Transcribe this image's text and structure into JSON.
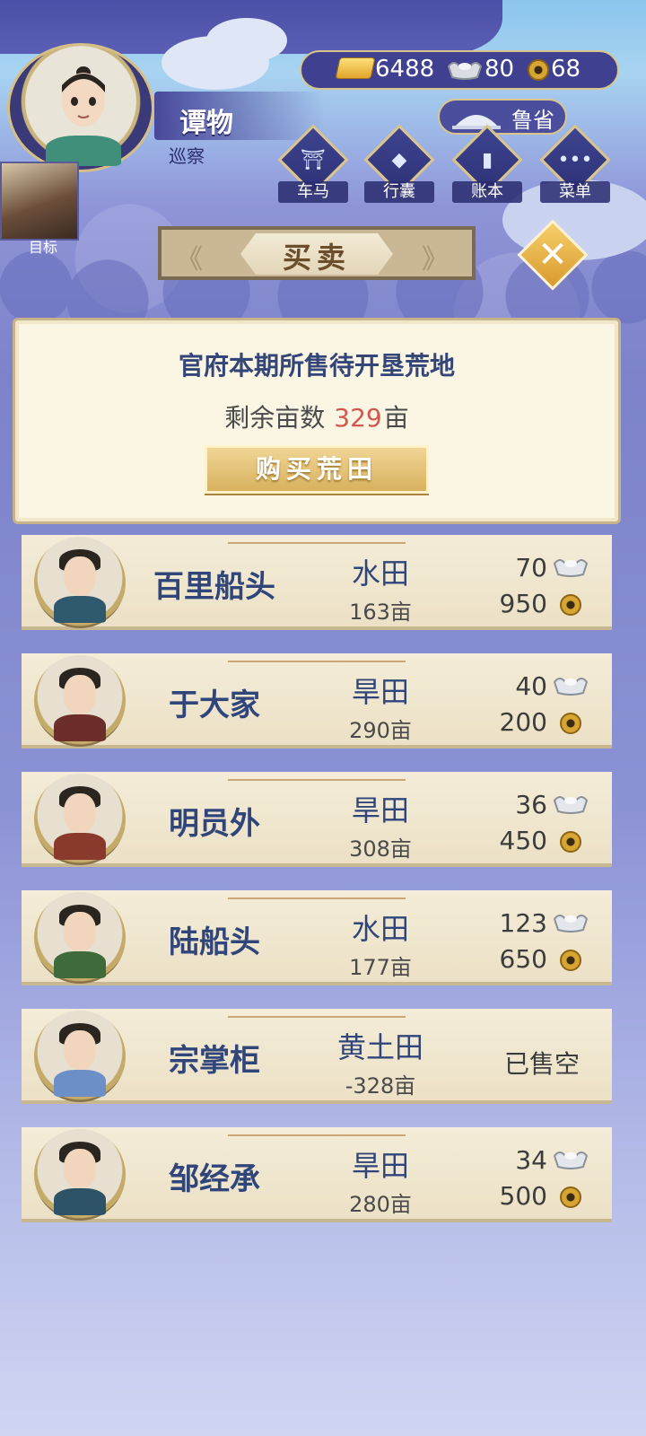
{
  "player": {
    "name": "谭物",
    "title": "巡察",
    "target_label": "目标"
  },
  "currency": {
    "gold": "6488",
    "silver": "80",
    "copper": "68"
  },
  "region": {
    "label": "鲁省",
    "icon": "stone-bridge-icon"
  },
  "nav": [
    {
      "label": "车马",
      "icon": "carriage-icon"
    },
    {
      "label": "行囊",
      "icon": "bag-icon"
    },
    {
      "label": "账本",
      "icon": "ledger-icon"
    },
    {
      "label": "菜单",
      "icon": "menu-dots-icon"
    }
  ],
  "panel": {
    "title": "买卖",
    "close_icon": "close-icon"
  },
  "government": {
    "heading": "官府本期所售待开垦荒地",
    "remain_label": "剩余亩数",
    "remain_value": "329",
    "remain_unit": "亩",
    "buy_button": "购买荒田"
  },
  "colors": {
    "accent_gold": "#d8b15e",
    "title_blue": "#30467a",
    "remain_red": "#d2574f",
    "bg_purple": "#7d82c9"
  },
  "sellers": [
    {
      "name": "百里船头",
      "land": "水田",
      "area": "163亩",
      "silver": "70",
      "copper": "950",
      "sold_out": "",
      "body_color": "#2f5a6e"
    },
    {
      "name": "于大家",
      "land": "旱田",
      "area": "290亩",
      "silver": "40",
      "copper": "200",
      "sold_out": "",
      "body_color": "#6b2e2a"
    },
    {
      "name": "明员外",
      "land": "旱田",
      "area": "308亩",
      "silver": "36",
      "copper": "450",
      "sold_out": "",
      "body_color": "#8a3a2c"
    },
    {
      "name": "陆船头",
      "land": "水田",
      "area": "177亩",
      "silver": "123",
      "copper": "650",
      "sold_out": "",
      "body_color": "#3f6a3a"
    },
    {
      "name": "宗掌柜",
      "land": "黄土田",
      "area": "-328亩",
      "silver": "",
      "copper": "",
      "sold_out": "已售空",
      "body_color": "#6d8fc9"
    },
    {
      "name": "邹经承",
      "land": "旱田",
      "area": "280亩",
      "silver": "34",
      "copper": "500",
      "sold_out": "",
      "body_color": "#2e5266"
    }
  ]
}
